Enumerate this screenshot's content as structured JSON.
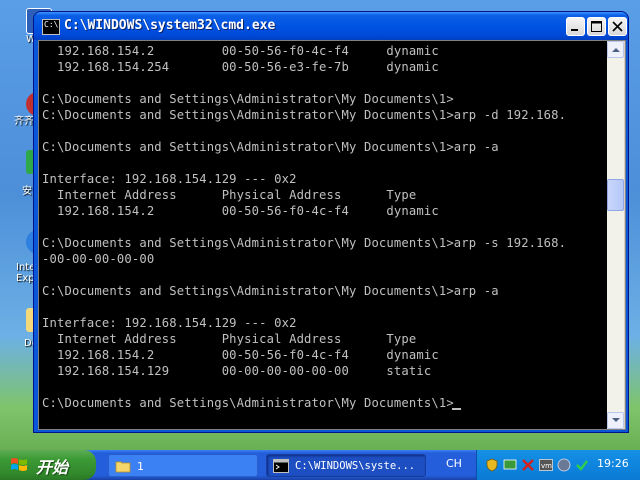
{
  "window": {
    "title": "C:\\WINDOWS\\system32\\cmd.exe"
  },
  "console": {
    "lines": [
      "  192.168.154.2         00-50-56-f0-4c-f4     dynamic",
      "  192.168.154.254       00-50-56-e3-fe-7b     dynamic",
      "",
      "C:\\Documents and Settings\\Administrator\\My Documents\\1>",
      "C:\\Documents and Settings\\Administrator\\My Documents\\1>arp -d 192.168.",
      "",
      "C:\\Documents and Settings\\Administrator\\My Documents\\1>arp -a",
      "",
      "Interface: 192.168.154.129 --- 0x2",
      "  Internet Address      Physical Address      Type",
      "  192.168.154.2         00-50-56-f0-4c-f4     dynamic",
      "",
      "C:\\Documents and Settings\\Administrator\\My Documents\\1>arp -s 192.168.",
      "-00-00-00-00-00",
      "",
      "C:\\Documents and Settings\\Administrator\\My Documents\\1>arp -a",
      "",
      "Interface: 192.168.154.129 --- 0x2",
      "  Internet Address      Physical Address      Type",
      "  192.168.154.2         00-50-56-f0-4c-f4     dynamic",
      "  192.168.154.129       00-00-00-00-00-00     static",
      "",
      "C:\\Documents and Settings\\Administrator\\My Documents\\1>"
    ]
  },
  "desktop": {
    "icons": [
      {
        "label": "W",
        "icon": "document-icon"
      },
      {
        "label": "齐齐",
        "icon": "shortcut-icon"
      },
      {
        "label": "安",
        "icon": "app-icon"
      },
      {
        "label": "Inte Expl",
        "icon": "ie-icon"
      },
      {
        "label": "De",
        "icon": "folder-icon"
      }
    ]
  },
  "taskbar": {
    "start_label": "开始",
    "tasks": [
      {
        "label": "1",
        "icon": "folder-icon"
      },
      {
        "label": "C:\\WINDOWS\\syste...",
        "icon": "cmd-icon"
      }
    ],
    "language": "CH",
    "clock": "19:26"
  }
}
